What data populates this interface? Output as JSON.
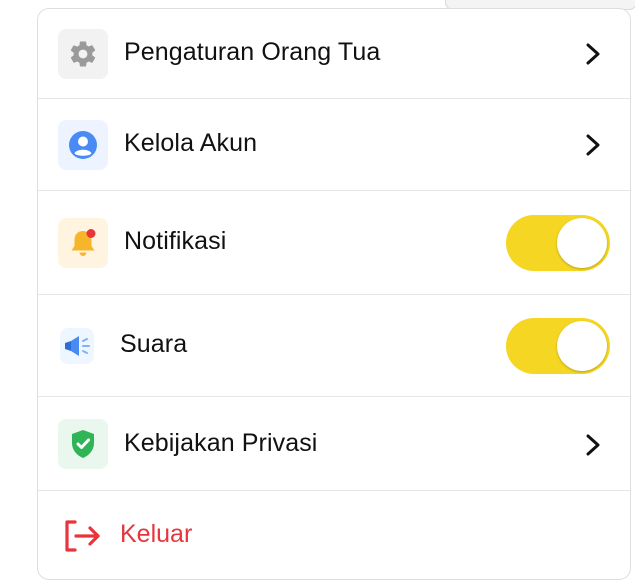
{
  "menu": {
    "items": [
      {
        "label": "Pengaturan Orang Tua",
        "icon": "gear-icon",
        "control": "chevron"
      },
      {
        "label": "Kelola Akun",
        "icon": "user-icon",
        "control": "chevron"
      },
      {
        "label": "Notifikasi",
        "icon": "bell-icon",
        "control": "toggle",
        "enabled": true
      },
      {
        "label": "Suara",
        "icon": "megaphone-icon",
        "control": "toggle",
        "enabled": true
      },
      {
        "label": "Kebijakan Privasi",
        "icon": "shield-check-icon",
        "control": "chevron"
      }
    ],
    "logout_label": "Keluar"
  },
  "colors": {
    "toggle_on": "#f5d622",
    "logout": "#e8343b",
    "user_icon": "#4a8af4",
    "bell_icon": "#f7b52b",
    "shield_icon": "#2fb457"
  }
}
